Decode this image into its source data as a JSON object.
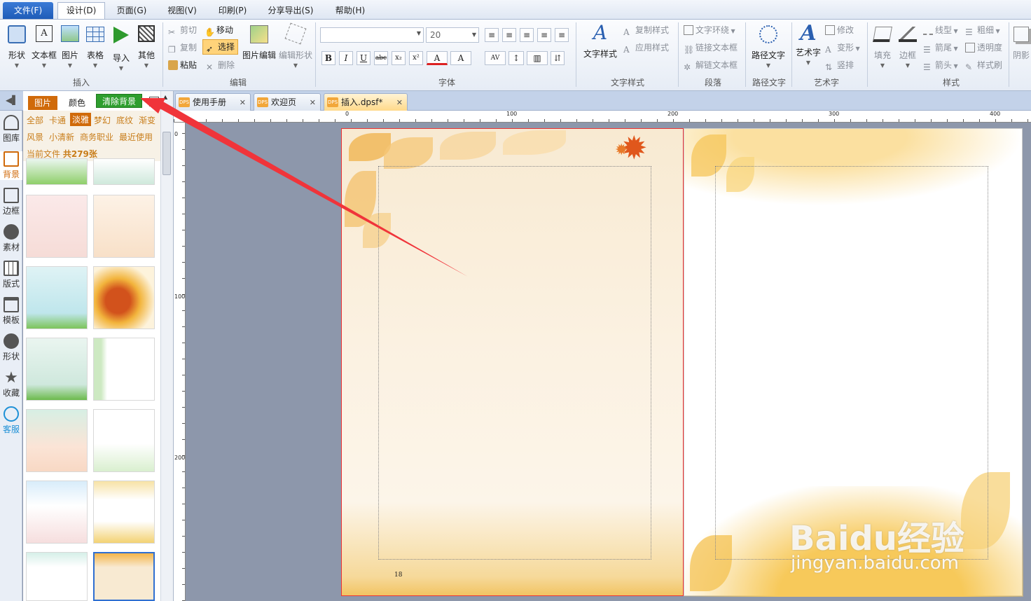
{
  "menubar": {
    "file": "文件(F)",
    "design": "设计(D)",
    "page": "页面(G)",
    "view": "视图(V)",
    "print": "印刷(P)",
    "share": "分享导出(S)",
    "help": "帮助(H)"
  },
  "ribbon": {
    "insert": {
      "shape": "形状",
      "textbox": "文本框",
      "picture": "图片",
      "table": "表格",
      "import": "导入",
      "other": "其他",
      "label": "插入"
    },
    "edit": {
      "cut": "剪切",
      "move": "移动",
      "copy": "复制",
      "select": "选择",
      "paste": "粘贴",
      "delete": "删除",
      "image_edit": "图片编辑",
      "edit_shape": "编辑形状",
      "label": "编辑"
    },
    "font": {
      "font_name": "",
      "font_size": "20",
      "label": "字体"
    },
    "text_style": {
      "text_style": "文字样式",
      "copy_style": "复制样式",
      "apply_style": "应用样式",
      "label": "文字样式"
    },
    "paragraph": {
      "wrap": "文字环绕",
      "link": "链接文本框",
      "unlink": "解链文本框",
      "label": "段落"
    },
    "path_text": {
      "path_text": "路径文字",
      "label": "路径文字"
    },
    "art_text": {
      "art_text": "艺术字",
      "modify": "修改",
      "transform": "变形",
      "vertical": "竖排",
      "label": "艺术字"
    },
    "style": {
      "fill": "填充",
      "border": "边框",
      "line_type": "线型",
      "thickness": "粗细",
      "arrow_end": "箭尾",
      "transparency": "透明度",
      "arrow_head": "箭头",
      "style_brush": "样式刷",
      "shadow": "阴影",
      "label": "样式"
    }
  },
  "tabs": [
    {
      "label": "使用手册",
      "icon": "DPS"
    },
    {
      "label": "欢迎页",
      "icon": "DPS"
    },
    {
      "label": "插入.dpsf*",
      "icon": "DPS"
    }
  ],
  "leftbar": [
    "图库",
    "背景",
    "边框",
    "素材",
    "版式",
    "模板",
    "形状",
    "收藏",
    "客服"
  ],
  "panel": {
    "tab_picture": "图片",
    "tab_color": "颜色",
    "clear_bg": "清除背景",
    "categories_row1": [
      "全部",
      "卡通",
      "淡雅",
      "梦幻",
      "底纹",
      "渐变"
    ],
    "categories_row2": [
      "风景",
      "小清新",
      "商务职业",
      "最近使用"
    ],
    "active_category": "淡雅",
    "current_file_label": "当前文件",
    "count_label": "共279张"
  },
  "ruler": {
    "h": [
      "0",
      "100",
      "200",
      "300",
      "400"
    ],
    "v": [
      "0",
      "100",
      "200"
    ]
  },
  "page": {
    "number": "18"
  },
  "watermark": {
    "brand": "Baidu经验",
    "url": "jingyan.baidu.com"
  },
  "colors": {
    "accent": "#e07a12",
    "clear_bg": "#2e9e2e",
    "file_menu": "#1f5cb8",
    "page_border": "#e33"
  }
}
